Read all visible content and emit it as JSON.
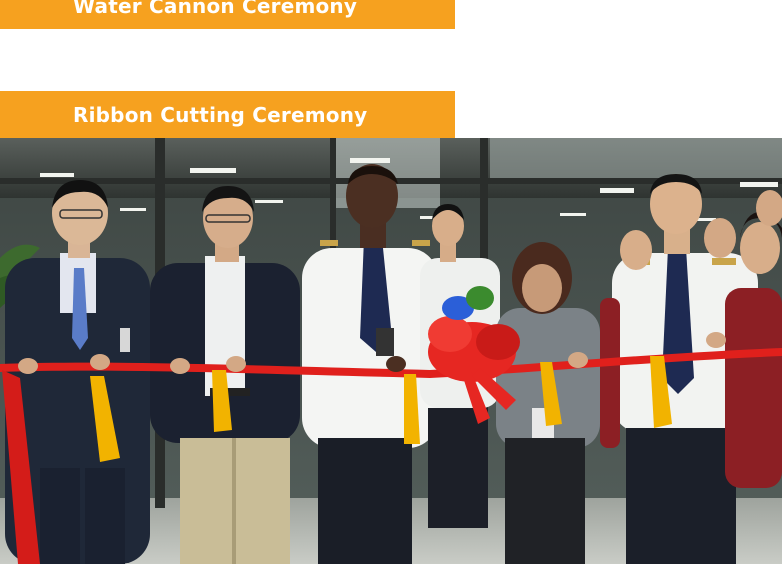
{
  "sections": [
    {
      "heading": "Water Cannon Ceremony"
    },
    {
      "heading": "Ribbon Cutting Ceremony"
    }
  ],
  "photo": {
    "subject": "ribbon-cutting-photo"
  },
  "colors": {
    "banner_bg": "#f6a11f",
    "banner_text": "#ffffff",
    "ribbon": "#e0201c",
    "ceiling": "#3a3f3c",
    "floor": "#b9bcb6"
  }
}
